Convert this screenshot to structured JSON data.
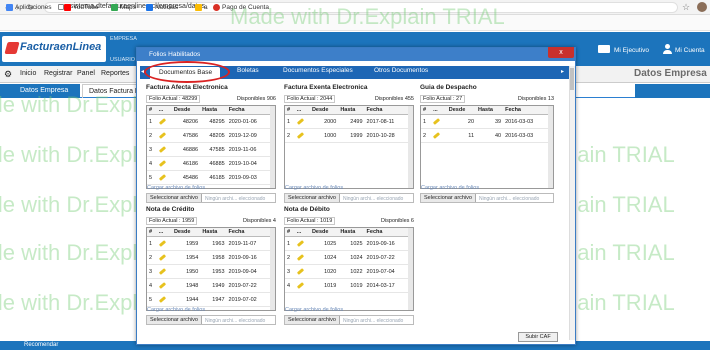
{
  "browser": {
    "url": "sistema.dtefacturaenlinea.cl/empresa/datos",
    "bookmarks": [
      "Aplicaciones",
      "YouTube",
      "Maps",
      "Noticias",
      "a",
      "Pago de Cuenta"
    ],
    "bookmark_colors": [
      "#4285f4",
      "#ff0000",
      "#34a853",
      "#1a73e8",
      "#fbbc04",
      "#d93025"
    ]
  },
  "site": {
    "logo": "FacturaenLinea",
    "empresa_label": "EMPRESA",
    "usuario_label": "USUARIO",
    "mi_ejecutivo": "Mi Ejecutivo",
    "mi_cuenta": "Mi Cuenta",
    "menu": [
      "Inicio",
      "Registrar",
      "Panel",
      "Reportes"
    ],
    "page_title": "Datos Empresa",
    "tabs": [
      "Datos Empresa",
      "Datos Factura El"
    ],
    "recomendar": "Recomendar",
    "brand_color": "#1c74bc"
  },
  "watermark": "Made with Dr.Explain TRIAL",
  "modal": {
    "title": "Folios Habilitados",
    "close": "x",
    "tabs": [
      "Documentos Base",
      "Boletas",
      "Documentos Especiales",
      "Otros Documentos"
    ],
    "upload_button": "Subir CAF",
    "cargar_label": "Cargar archivo de folios",
    "select_label": "Seleccionar archivo",
    "no_file": "Ningún archi... eleccionado",
    "columns": [
      "#",
      "...",
      "Desde",
      "Hasta",
      "Fecha"
    ],
    "panels": [
      {
        "title": "Factura Afecta Electronica",
        "folio": "Folio Actual : 48299",
        "disponibles": "Disponibles 906",
        "rows": [
          [
            "1",
            "48206",
            "48295",
            "2020-01-06"
          ],
          [
            "2",
            "47586",
            "48205",
            "2019-12-09"
          ],
          [
            "3",
            "46886",
            "47585",
            "2019-11-06"
          ],
          [
            "4",
            "46186",
            "46885",
            "2019-10-04"
          ],
          [
            "5",
            "45486",
            "46185",
            "2019-09-03"
          ]
        ]
      },
      {
        "title": "Factura Exenta Electronica",
        "folio": "Folio Actual : 2044",
        "disponibles": "Disponibles 455",
        "rows": [
          [
            "1",
            "2000",
            "2499",
            "2017-08-11"
          ],
          [
            "2",
            "1000",
            "1999",
            "2010-10-28"
          ]
        ]
      },
      {
        "title": "Guia de Despacho",
        "folio": "Folio Actual : 27",
        "disponibles": "Disponibles 13",
        "rows": [
          [
            "1",
            "20",
            "39",
            "2016-03-03"
          ],
          [
            "2",
            "11",
            "40",
            "2016-03-03"
          ]
        ]
      },
      {
        "title": "Nota de Crédito",
        "folio": "Folio Actual : 1959",
        "disponibles": "Disponibles 4",
        "rows": [
          [
            "1",
            "1959",
            "1963",
            "2019-11-07"
          ],
          [
            "2",
            "1954",
            "1958",
            "2019-09-16"
          ],
          [
            "3",
            "1950",
            "1953",
            "2019-09-04"
          ],
          [
            "4",
            "1948",
            "1949",
            "2019-07-22"
          ],
          [
            "5",
            "1944",
            "1947",
            "2019-07-02"
          ]
        ]
      },
      {
        "title": "Nota de Débito",
        "folio": "Folio Actual : 1019",
        "disponibles": "Disponibles 6",
        "rows": [
          [
            "1",
            "1025",
            "1025",
            "2019-09-16"
          ],
          [
            "2",
            "1024",
            "1024",
            "2019-07-22"
          ],
          [
            "3",
            "1020",
            "1022",
            "2019-07-04"
          ],
          [
            "4",
            "1019",
            "1019",
            "2014-03-17"
          ]
        ]
      }
    ]
  }
}
